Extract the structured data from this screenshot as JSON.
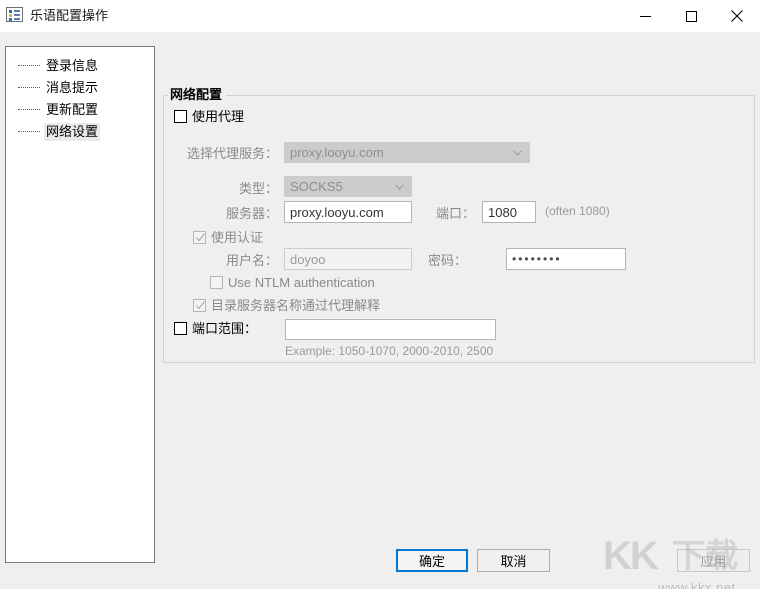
{
  "window": {
    "title": "乐语配置操作",
    "icon": "list-view-icon",
    "controls": {
      "minimize": "−",
      "maximize": "□",
      "close": "✕"
    }
  },
  "sidebar": {
    "items": [
      {
        "label": "登录信息",
        "selected": false
      },
      {
        "label": "消息提示",
        "selected": false
      },
      {
        "label": "更新配置",
        "selected": false
      },
      {
        "label": "网络设置",
        "selected": true
      }
    ]
  },
  "group": {
    "title": "网络配置"
  },
  "form": {
    "use_proxy": {
      "label": "使用代理",
      "checked": false,
      "disabled": false
    },
    "proxy_service": {
      "label": "选择代理服务：",
      "value": "proxy.looyu.com",
      "disabled": true
    },
    "type": {
      "label": "类型：",
      "value": "SOCKS5",
      "disabled": true
    },
    "server": {
      "label": "服务器：",
      "value": "proxy.looyu.com",
      "disabled": false
    },
    "port": {
      "label": "端口：",
      "value": "1080",
      "hint": "(often 1080)",
      "disabled": false
    },
    "use_auth": {
      "label": "使用认证",
      "checked": true,
      "disabled": true
    },
    "username": {
      "label": "用户名：",
      "value": "doyoo",
      "disabled": true
    },
    "password": {
      "label": "密码：",
      "value": "••••••••",
      "disabled": false
    },
    "ntlm": {
      "label": "Use NTLM authentication",
      "checked": false,
      "disabled": true
    },
    "resolve_via_proxy": {
      "label": "目录服务器名称通过代理解释",
      "checked": true,
      "disabled": true
    },
    "port_range": {
      "label": "端口范围：",
      "checked": false,
      "value": "",
      "example": "Example: 1050-1070, 2000-2010, 2500"
    }
  },
  "footer": {
    "ok": "确定",
    "cancel": "取消",
    "apply": "应用"
  },
  "watermark": {
    "kk": "KK",
    "cn": "下载",
    "url": "www.kkx.net"
  },
  "colors": {
    "accent": "#0078d7",
    "window_bg": "#efefef",
    "panel_bg": "#ffffff",
    "disabled_text": "#8a8a8a"
  }
}
